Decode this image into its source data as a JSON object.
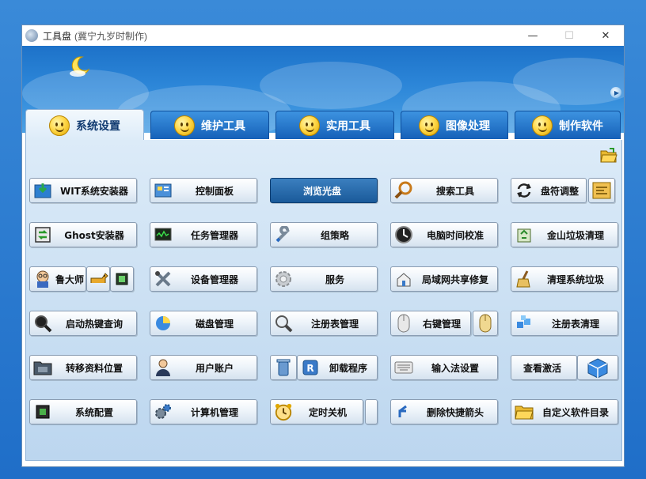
{
  "window": {
    "title": "工具盘",
    "subtitle": "(冀宁九岁时制作)",
    "minimize": "—",
    "maximize": "☐",
    "close": "✕"
  },
  "tabs": [
    {
      "label": "系统设置",
      "active": true
    },
    {
      "label": "维护工具",
      "active": false
    },
    {
      "label": "实用工具",
      "active": false
    },
    {
      "label": "图像处理",
      "active": false
    },
    {
      "label": "制作软件",
      "active": false
    }
  ],
  "buttons": {
    "r1": [
      "WIT系统安装器",
      "控制面板",
      "浏览光盘",
      "搜索工具",
      "盘符调整"
    ],
    "r2": [
      "Ghost安装器",
      "任务管理器",
      "组策略",
      "电脑时间校准",
      "金山垃圾清理"
    ],
    "r3": [
      "鲁大师",
      "设备管理器",
      "服务",
      "局域网共享修复",
      "清理系统垃圾"
    ],
    "r4": [
      "启动热键查询",
      "磁盘管理",
      "注册表管理",
      "右键管理",
      "注册表清理"
    ],
    "r5": [
      "转移资料位置",
      "用户账户",
      "卸载程序",
      "输入法设置",
      "查看激活"
    ],
    "r6": [
      "系统配置",
      "计算机管理",
      "定时关机",
      "删除快捷箭头",
      "自定义软件目录"
    ]
  },
  "watermark": "",
  "icons": {
    "primary": "#1560b8",
    "accent": "#ffd84a"
  }
}
